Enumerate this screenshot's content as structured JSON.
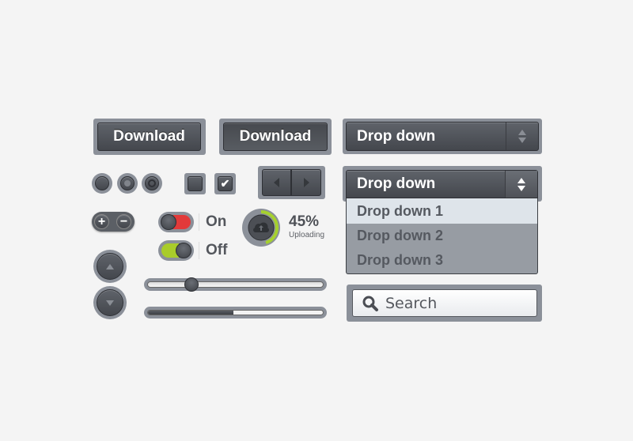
{
  "buttons": {
    "download_1": "Download",
    "download_2": "Download"
  },
  "dropdown_closed": {
    "label": "Drop down"
  },
  "dropdown_open": {
    "label": "Drop down",
    "options": [
      "Drop down 1",
      "Drop down 2",
      "Drop down 3"
    ],
    "highlighted": 0
  },
  "toggles": {
    "on_label": "On",
    "off_label": "Off",
    "on_color": "#e23a3a",
    "off_color": "#a9cc2a"
  },
  "upload": {
    "percent_label": "45%",
    "status": "Uploading",
    "progress": 45,
    "accent": "#a6d12e"
  },
  "stepper": {
    "plus": "+",
    "minus": "−"
  },
  "slider": {
    "value": 23
  },
  "progress_bar": {
    "value": 49
  },
  "search": {
    "placeholder": "Search"
  },
  "checkboxes": [
    {
      "checked": false
    },
    {
      "checked": true
    }
  ],
  "radios": [
    {
      "state": "empty"
    },
    {
      "state": "dot"
    },
    {
      "state": "ring"
    }
  ]
}
